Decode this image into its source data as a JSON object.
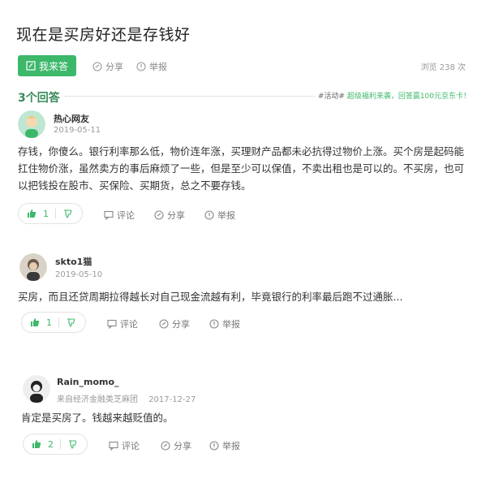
{
  "question": {
    "title": "现在是买房好还是存钱好",
    "answer_button": "我来答",
    "share": "分享",
    "report": "举报",
    "views": "浏览 238 次"
  },
  "answers_header": {
    "count": "3个回答",
    "promo_tag": "#活动#",
    "promo_text": "超级福利来袭，回答赢100元京东卡！"
  },
  "answers": [
    {
      "user": "热心网友",
      "source": "",
      "date": "2019-05-11",
      "content": "存钱，你傻么。银行利率那么低，物价连年涨，买理财产品都未必抗得过物价上涨。买个房是起码能扛住物价涨，虽然卖方的事后麻烦了一些，但是至少可以保值，不卖出租也是可以的。不买房，也可以把钱投在股市、买保险、买期货，总之不要存钱。",
      "likes": "1",
      "comment": "评论",
      "share": "分享",
      "report": "举报"
    },
    {
      "user": "skto1猫",
      "source": "",
      "date": "2019-05-10",
      "content": "买房，而且还贷周期拉得越长对自己现金流越有利，毕竟银行的利率最后跑不过通胀...",
      "likes": "1",
      "comment": "评论",
      "share": "分享",
      "report": "举报"
    },
    {
      "user": "Rain_momo_",
      "source": "来自经济金融类芝麻团",
      "date": "2017-12-27",
      "content": "肯定是买房了。钱越来越贬值的。",
      "likes": "2",
      "comment": "评论",
      "share": "分享",
      "report": "举报"
    }
  ],
  "colors": {
    "accent": "#3db86b"
  }
}
